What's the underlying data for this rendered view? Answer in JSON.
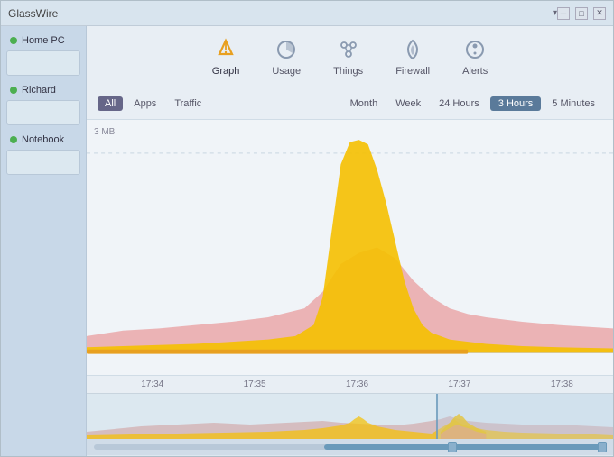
{
  "titleBar": {
    "appName": "GlassWire",
    "chevron": "▾",
    "minimizeLabel": "─",
    "maximizeLabel": "□",
    "closeLabel": "✕"
  },
  "sidebar": {
    "items": [
      {
        "name": "Home PC",
        "active": true
      },
      {
        "name": "Richard",
        "active": true
      },
      {
        "name": "Notebook",
        "active": true
      }
    ]
  },
  "nav": {
    "items": [
      {
        "id": "graph",
        "label": "Graph",
        "active": true
      },
      {
        "id": "usage",
        "label": "Usage",
        "active": false
      },
      {
        "id": "things",
        "label": "Things",
        "active": false
      },
      {
        "id": "firewall",
        "label": "Firewall",
        "active": false
      },
      {
        "id": "alerts",
        "label": "Alerts",
        "active": false
      }
    ]
  },
  "filters": {
    "typeButtons": [
      {
        "label": "All",
        "active": true
      },
      {
        "label": "Apps",
        "active": false
      },
      {
        "label": "Traffic",
        "active": false
      }
    ],
    "timeButtons": [
      {
        "label": "Month",
        "active": false
      },
      {
        "label": "Week",
        "active": false
      },
      {
        "label": "24 Hours",
        "active": false
      },
      {
        "label": "3 Hours",
        "active": true
      },
      {
        "label": "5 Minutes",
        "active": false
      }
    ]
  },
  "graph": {
    "yLabel": "3 MB",
    "timeLabels": [
      "17:34",
      "17:35",
      "17:36",
      "17:37",
      "17:38"
    ]
  },
  "colors": {
    "accent": "#5a7a9a",
    "graphYellow": "#f5c000",
    "graphPink": "#e89090",
    "graphOrange": "#e8a060"
  }
}
